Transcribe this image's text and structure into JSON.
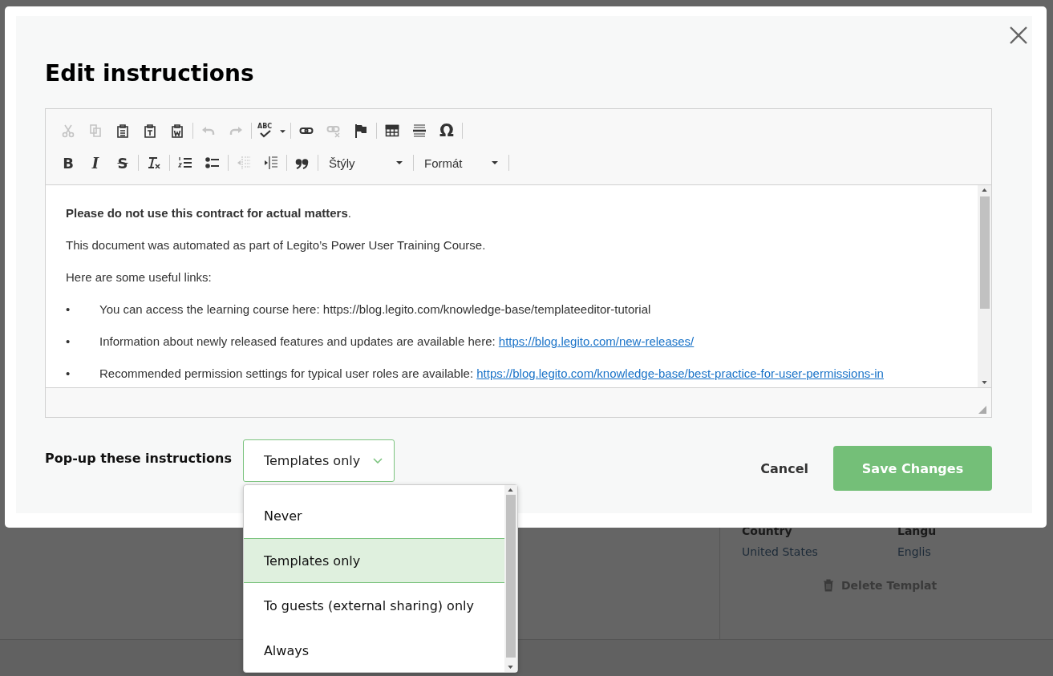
{
  "background_page": {
    "details": [
      {
        "label": "Country",
        "value": "United States"
      },
      {
        "label": "Langu",
        "value": "Englis"
      }
    ],
    "delete_link": "Delete Templat"
  },
  "dialog": {
    "title": "Edit instructions",
    "editor": {
      "toolbar": [
        [
          [
            {
              "kind": "cut",
              "disabled": true
            },
            {
              "kind": "copy",
              "disabled": true
            },
            {
              "kind": "paste",
              "disabled": false
            },
            {
              "kind": "pastetext",
              "disabled": false
            },
            {
              "kind": "pasteword",
              "disabled": false
            }
          ],
          [
            {
              "kind": "undo",
              "disabled": true
            },
            {
              "kind": "redo",
              "disabled": true
            }
          ],
          [
            {
              "kind": "spell",
              "label": "ABC",
              "disabled": false
            }
          ],
          [
            {
              "kind": "link",
              "disabled": false
            },
            {
              "kind": "unlink",
              "disabled": true
            },
            {
              "kind": "flag",
              "disabled": false
            }
          ],
          [
            {
              "kind": "table",
              "disabled": false
            },
            {
              "kind": "rule",
              "disabled": false
            },
            {
              "kind": "char",
              "label": "Ω",
              "disabled": false
            }
          ]
        ],
        [
          [
            {
              "kind": "bold",
              "label": "B",
              "disabled": false
            },
            {
              "kind": "italic",
              "label": "I",
              "disabled": false
            },
            {
              "kind": "strike",
              "label": "S",
              "disabled": false
            }
          ],
          [
            {
              "kind": "clear",
              "disabled": false
            }
          ],
          [
            {
              "kind": "ol",
              "disabled": false
            },
            {
              "kind": "ul",
              "disabled": false
            }
          ],
          [
            {
              "kind": "outdent",
              "disabled": true
            },
            {
              "kind": "indent",
              "disabled": false
            }
          ],
          [
            {
              "kind": "quote",
              "disabled": false
            }
          ],
          [
            {
              "kind": "combo",
              "label": "Štýly"
            }
          ],
          [
            {
              "kind": "combo",
              "label": "Formát"
            }
          ]
        ]
      ],
      "content": [
        {
          "kind": "paragraph",
          "text": "**Please do not use this contract for actual matters**."
        },
        {
          "kind": "paragraph",
          "text": "This document was automated as part of Legito’s Power User Training Course."
        },
        {
          "kind": "paragraph",
          "text": "Here are some useful links:"
        },
        {
          "kind": "bullet",
          "marker": "•",
          "text": "You can access the learning course here: https://blog.legito.com/knowledge-base/templateeditor-tutorial"
        },
        {
          "kind": "bullet",
          "marker": "•",
          "text": "Information about newly released features and updates are available here: ",
          "link": "https://blog.legito.com/new-releases/"
        },
        {
          "kind": "bullet",
          "marker": "•",
          "text": "Recommended permission settings for typical user roles are available: ",
          "link": "https://blog.legito.com/knowledge-base/best-practice-for-user-permissions-in"
        }
      ]
    },
    "popup_setting": {
      "label": "Pop-up these instructions",
      "value": "Templates only",
      "expanded": true,
      "options": [
        {
          "label": "Never",
          "selected": false
        },
        {
          "label": "Templates only",
          "selected": true
        },
        {
          "label": "To guests (external sharing) only",
          "selected": false
        },
        {
          "label": "Always",
          "selected": false
        }
      ]
    },
    "buttons": {
      "cancel": "Cancel",
      "save": "Save Changes"
    }
  }
}
